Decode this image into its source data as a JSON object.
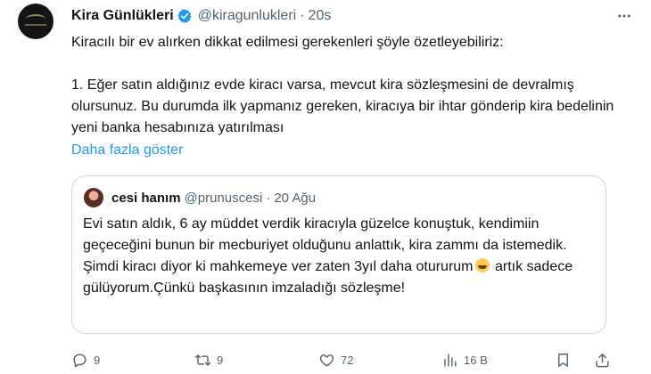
{
  "author": {
    "name": "Kira Günlükleri",
    "handle": "@kiragunlukleri",
    "time": "20s",
    "verified": true
  },
  "tweet": {
    "line1": "Kiracılı bir ev alırken dikkat edilmesi gerekenleri şöyle özetleyebiliriz:",
    "para2": "1. Eğer satın aldığınız evde kiracı varsa, mevcut kira sözleşmesini de devralmış olursunuz. Bu durumda ilk yapmanız gereken, kiracıya bir ihtar gönderip kira bedelinin yeni banka hesabınıza yatırılması",
    "show_more": "Daha fazla göster"
  },
  "quote": {
    "name": "cesi hanım",
    "handle": "@prunuscesi",
    "date": "20 Ağu",
    "text_before_emoji": "Evi satın aldık, 6 ay müddet verdik kiracıyla güzelce konuştuk, kendimiin geçeceğini bunun bir mecburiyet olduğunu anlattık, kira zammı da istemedik. Şimdi kiracı diyor ki mahkemeye ver zaten 3yıl daha otururum",
    "text_after_emoji": " artık sadece gülüyorum.Çünkü başkasının imzaladığı sözleşme!",
    "emoji": "grinning-sweat-emoji"
  },
  "actions": {
    "replies": "9",
    "reposts": "9",
    "likes": "72",
    "views": "16 B"
  },
  "colors": {
    "link": "#1d9bf0",
    "verified": "#1d9bf0",
    "secondary_text": "#536471",
    "border": "#cfd9de"
  }
}
